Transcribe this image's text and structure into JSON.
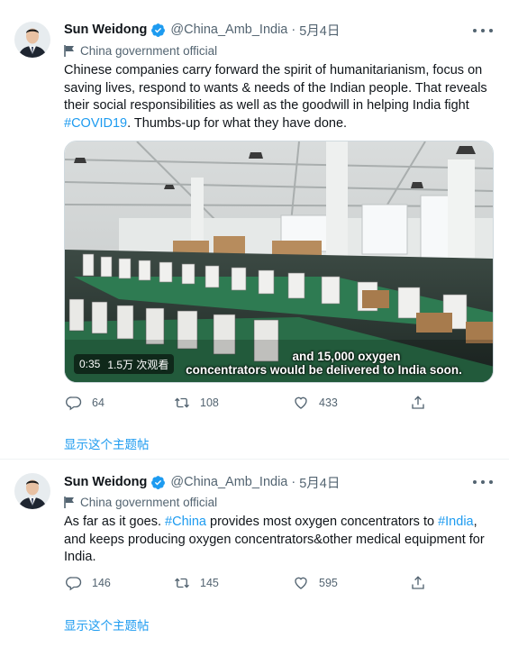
{
  "tweets": [
    {
      "author_name": "Sun Weidong",
      "handle": "@China_Amb_India",
      "separator": "·",
      "date": "5月4日",
      "account_label": "China government official",
      "text_segments": [
        "Chinese companies carry forward the spirit of humanitarianism,  focus on saving lives, respond to  wants & needs of the Indian people. That reveals their social responsibilities as well as the goodwill in helping India fight ",
        "#COVID19",
        ". Thumbs-up for what they have done."
      ],
      "media": {
        "video_duration": "0:35",
        "video_views": "1.5万 次观看",
        "caption_line_1": "and 15,000 oxygen",
        "caption_line_2": "concentrators would be delivered to India soon."
      },
      "actions": {
        "replies": "64",
        "retweets": "108",
        "likes": "433"
      },
      "show_thread": "显示这个主题帖"
    },
    {
      "author_name": "Sun Weidong",
      "handle": "@China_Amb_India",
      "separator": "·",
      "date": "5月4日",
      "account_label": "China government official",
      "text_segments": [
        "As far as it goes. ",
        "#China",
        " provides most oxygen concentrators to ",
        "#India",
        ",\nand keeps producing oxygen concentrators&other medical equipment for India."
      ],
      "actions": {
        "replies": "146",
        "retweets": "145",
        "likes": "595"
      },
      "show_thread": "显示这个主题帖"
    }
  ],
  "icons": {
    "verified": "verified-badge-icon",
    "flag": "flag-icon",
    "more": "more-options-icon",
    "reply": "reply-icon",
    "retweet": "retweet-icon",
    "like": "heart-icon",
    "share": "share-icon"
  },
  "colors": {
    "link": "#1d9bf0",
    "secondary_text": "#536471",
    "primary_text": "#0f1419",
    "verified": "#1d9bf0"
  }
}
